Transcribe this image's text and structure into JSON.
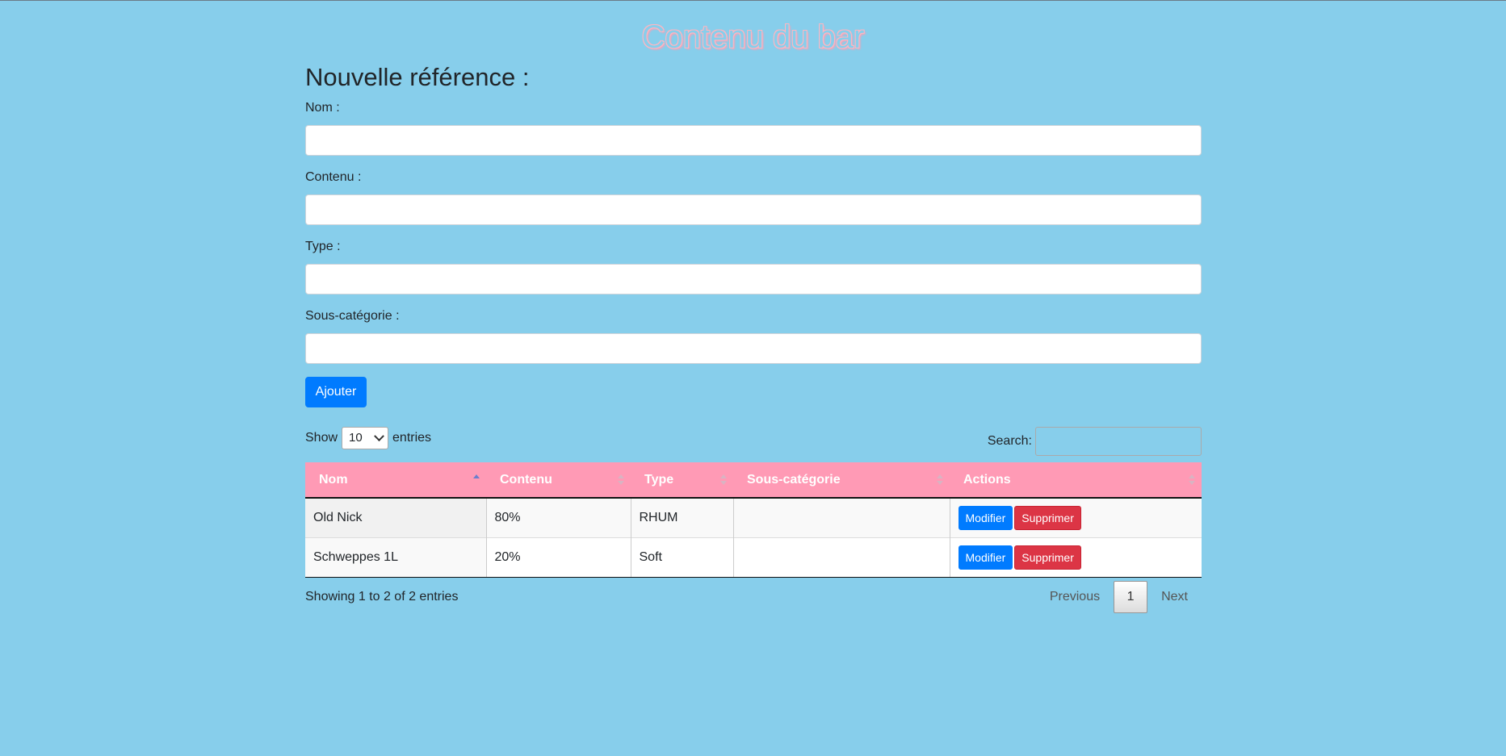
{
  "page": {
    "title": "Contenu du bar"
  },
  "form": {
    "heading": "Nouvelle référence :",
    "fields": [
      {
        "label": "Nom :",
        "value": ""
      },
      {
        "label": "Contenu :",
        "value": ""
      },
      {
        "label": "Type :",
        "value": ""
      },
      {
        "label": "Sous-catégorie :",
        "value": ""
      }
    ],
    "submit_label": "Ajouter"
  },
  "table_controls": {
    "show_label": "Show",
    "entries_label": "entries",
    "page_length": "10",
    "search_label": "Search:",
    "search_value": ""
  },
  "table": {
    "columns": [
      "Nom",
      "Contenu",
      "Type",
      "Sous-catégorie",
      "Actions"
    ],
    "sorted_column": "Nom",
    "sort_direction": "ascending",
    "rows": [
      {
        "nom": "Old Nick",
        "contenu": "80%",
        "type": "RHUM",
        "sous_categorie": "",
        "modify_label": "Modifier",
        "delete_label": "Supprimer"
      },
      {
        "nom": "Schweppes 1L",
        "contenu": "20%",
        "type": "Soft",
        "sous_categorie": "",
        "modify_label": "Modifier",
        "delete_label": "Supprimer"
      }
    ]
  },
  "footer": {
    "info": "Showing 1 to 2 of 2 entries",
    "previous_label": "Previous",
    "current_page": "1",
    "next_label": "Next"
  },
  "colors": {
    "background": "#87ceeb",
    "header": "#ff9ab5",
    "primary": "#007bff",
    "danger": "#dc3545"
  }
}
